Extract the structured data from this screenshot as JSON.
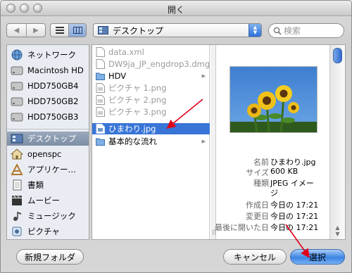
{
  "window": {
    "title": "開く"
  },
  "toolbar": {
    "back_icon": "chevron-left-icon",
    "forward_icon": "chevron-right-icon",
    "path_label": "デスクトップ",
    "search_placeholder": "検索"
  },
  "sidebar": {
    "devices": [
      {
        "label": "ネットワーク",
        "icon": "globe-icon"
      },
      {
        "label": "Macintosh HD",
        "icon": "hard-drive-icon"
      },
      {
        "label": "HDD750GB4",
        "icon": "hard-drive-icon"
      },
      {
        "label": "HDD750GB2",
        "icon": "hard-drive-icon"
      },
      {
        "label": "HDD750GB3",
        "icon": "hard-drive-icon"
      }
    ],
    "places": [
      {
        "label": "デスクトップ",
        "icon": "desktop-icon",
        "selected": true
      },
      {
        "label": "openspc",
        "icon": "home-icon"
      },
      {
        "label": "アプリケー…",
        "icon": "applications-icon"
      },
      {
        "label": "書類",
        "icon": "documents-icon"
      },
      {
        "label": "ムービー",
        "icon": "movies-icon"
      },
      {
        "label": "ミュージック",
        "icon": "music-icon"
      },
      {
        "label": "ピクチャ",
        "icon": "pictures-icon"
      }
    ]
  },
  "files": [
    {
      "name": "data.xml",
      "kind": "file",
      "dim": true
    },
    {
      "name": "DW9ja_JP_engdrop3.dmg",
      "kind": "file",
      "dim": true
    },
    {
      "name": "HDV",
      "kind": "folder",
      "dim": false
    },
    {
      "name": "ピクチャ 1.png",
      "kind": "file",
      "dim": true
    },
    {
      "name": "ピクチャ 2.png",
      "kind": "file",
      "dim": true
    },
    {
      "name": "ピクチャ 3.png",
      "kind": "file",
      "dim": true
    },
    {
      "name": "ひまわり.jpg",
      "kind": "image",
      "dim": false,
      "selected": true
    },
    {
      "name": "基本的な流れ",
      "kind": "folder",
      "dim": false
    }
  ],
  "preview": {
    "info": [
      {
        "key": "名前",
        "value": "ひまわり.jpg"
      },
      {
        "key": "サイズ",
        "value": "600 KB"
      },
      {
        "key": "種類",
        "value": "JPEG イメー"
      },
      {
        "key": "",
        "value": "ジ"
      },
      {
        "key": "作成日",
        "value": "今日の 17:21"
      },
      {
        "key": "変更日",
        "value": "今日の 17:21"
      },
      {
        "key": "最後に開いた日",
        "value": "今日の 17:21"
      }
    ]
  },
  "buttons": {
    "new_folder": "新規フォルダ",
    "cancel": "キャンセル",
    "open": "選択"
  },
  "colors": {
    "selection": "#3875d7",
    "annotation": "#e0001b"
  }
}
